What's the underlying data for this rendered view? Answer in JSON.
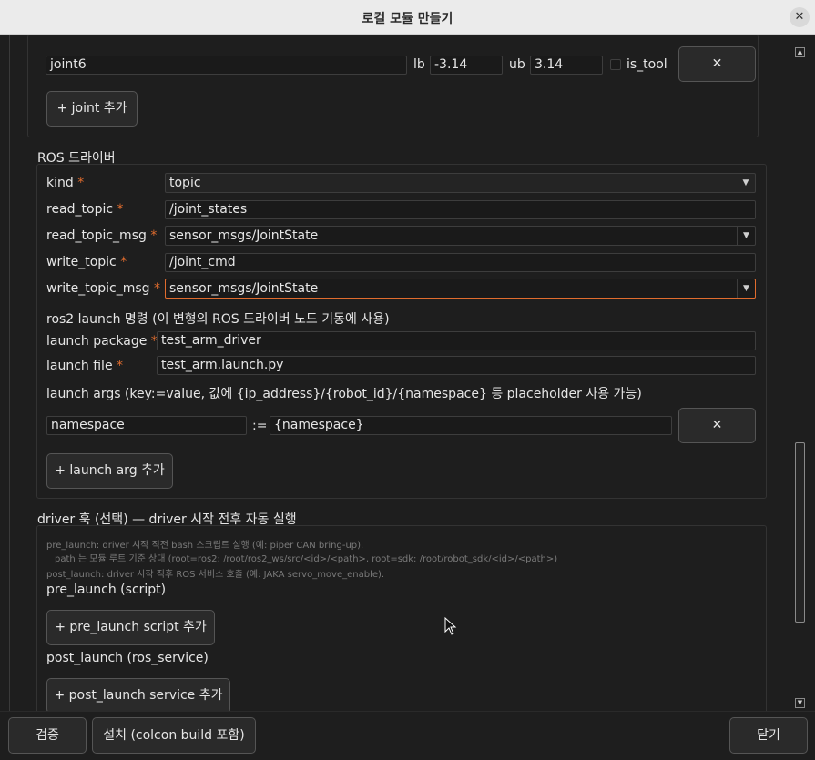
{
  "window": {
    "title": "로컬 모듈 만들기",
    "close_glyph": "✕"
  },
  "joints": {
    "last": {
      "name": "joint6",
      "lb_label": "lb",
      "lb_value": "-3.14",
      "ub_label": "ub",
      "ub_value": "3.14",
      "is_tool_label": "is_tool",
      "remove_glyph": "✕"
    },
    "add_label": "+ joint 추가"
  },
  "ros_driver": {
    "heading": "ROS 드라이버",
    "required_mark": "*",
    "kind": {
      "label": "kind",
      "value": "topic"
    },
    "read_topic": {
      "label": "read_topic",
      "value": "/joint_states"
    },
    "read_topic_msg": {
      "label": "read_topic_msg",
      "value": "sensor_msgs/JointState"
    },
    "write_topic": {
      "label": "write_topic",
      "value": "/joint_cmd"
    },
    "write_topic_msg": {
      "label": "write_topic_msg",
      "value": "sensor_msgs/JointState"
    },
    "launch_heading": "ros2 launch 명령 (이 변형의 ROS 드라이버 노드 기동에 사용)",
    "launch_package": {
      "label": "launch package",
      "value": "test_arm_driver"
    },
    "launch_file": {
      "label": "launch file",
      "value": "test_arm.launch.py"
    },
    "launch_args_heading": "launch args (key:=value, 값에 {ip_address}/{robot_id}/{namespace} 등 placeholder 사용 가능)",
    "launch_arg": {
      "key": "namespace",
      "assign": ":=",
      "value": "{namespace}",
      "remove_glyph": "✕"
    },
    "add_launch_arg_label": "+ launch arg 추가"
  },
  "driver_hooks": {
    "heading": "driver 훅 (선택) — driver 시작 전후 자동 실행",
    "help_line1": "pre_launch: driver 시작 직전 bash 스크립트 실행 (예: piper CAN bring-up).",
    "help_line2": "path 는 모듈 루트 기준 상대 (root=ros2: /root/ros2_ws/src/<id>/<path>, root=sdk: /root/robot_sdk/<id>/<path>)",
    "help_line3": "post_launch: driver 시작 직후 ROS 서비스 호출 (예: JAKA servo_move_enable).",
    "pre_launch_label": "pre_launch (script)",
    "add_pre_launch_label": "+ pre_launch script 추가",
    "post_launch_label": "post_launch (ros_service)",
    "add_post_launch_label": "+ post_launch service 추가"
  },
  "footer": {
    "validate_label": "검증",
    "install_label": "설치 (colcon build 포함)",
    "close_label": "닫기"
  },
  "scrollbar": {
    "up_glyph": "▲",
    "down_glyph": "▼"
  },
  "combo_arrow_glyph": "▼",
  "colors": {
    "accent": "#e06c2e",
    "background": "#1e1e1e",
    "titlebar": "#ebebeb"
  }
}
